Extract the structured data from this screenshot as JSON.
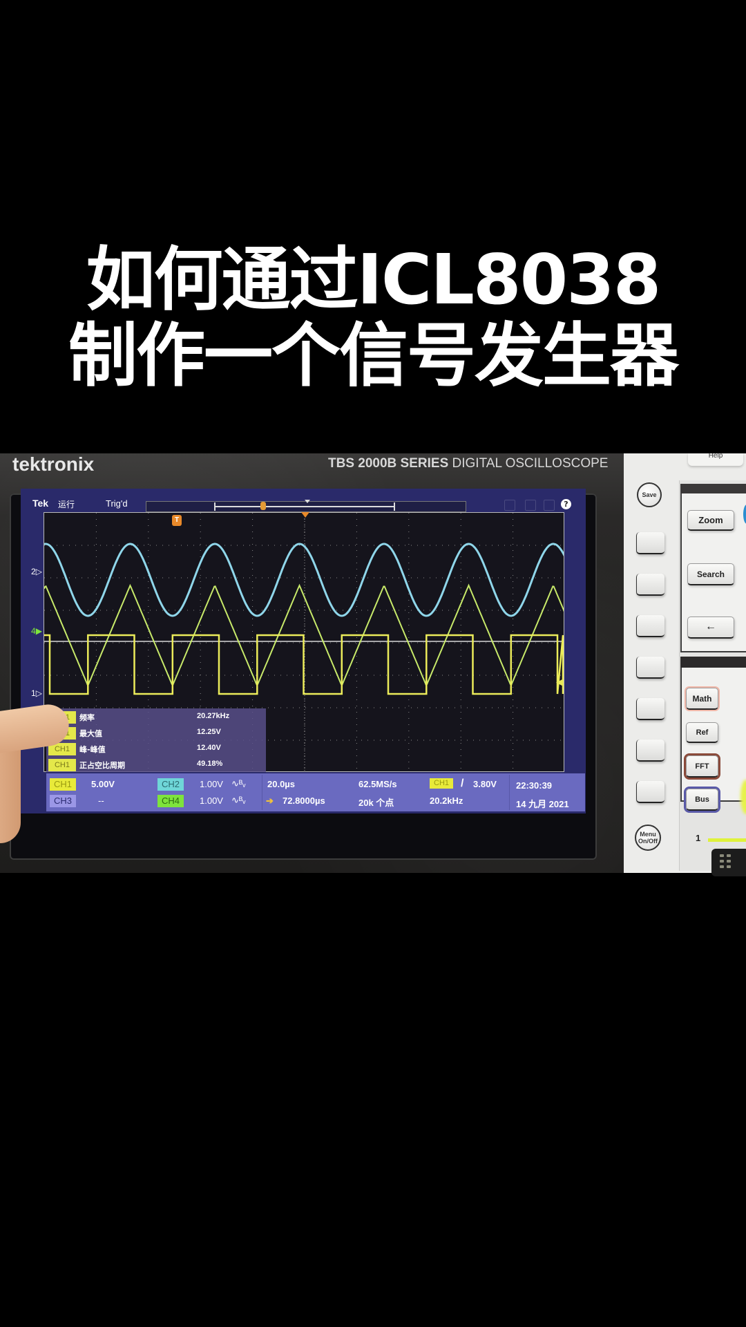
{
  "title": {
    "line1": "如何通过ICL8038",
    "line2": "制作一个信号发生器"
  },
  "instrument": {
    "brand": "tektronix",
    "model_bold": "TBS 2000B SERIES",
    "model_rest": "DIGITAL OSCILLOSCOPE"
  },
  "screen": {
    "topbar": {
      "tek": "Tek",
      "run_state": "运行",
      "trigger_state": "Trig'd",
      "help_icon": "?"
    },
    "channel_markers": {
      "ch2": "2",
      "ch4": "4",
      "ch1": "1",
      "trigger_marker": "T"
    },
    "waveforms": [
      {
        "channel": "CH2",
        "shape": "sine",
        "color": "#8fd6ea",
        "cycles_visible": 6
      },
      {
        "channel": "CH4",
        "shape": "triangle",
        "color": "#c8ea6a",
        "cycles_visible": 6
      },
      {
        "channel": "CH1",
        "shape": "square",
        "color": "#ecec5a",
        "cycles_visible": 6
      }
    ],
    "measurements": [
      {
        "channel": "CH1",
        "label": "频率",
        "value": "20.27kHz"
      },
      {
        "channel": "CH1",
        "label": "最大值",
        "value": "12.25V"
      },
      {
        "channel": "CH1",
        "label": "峰-峰值",
        "value": "12.40V"
      },
      {
        "channel": "CH1",
        "label": "正占空比周期",
        "value": "49.18%"
      }
    ],
    "status": {
      "ch1_label": "CH1",
      "ch1_scale": "5.00V",
      "ch2_label": "CH2",
      "ch2_scale": "1.00V",
      "ch2_coupling": "∿ᴮᵥ",
      "ch3_label": "CH3",
      "ch3_scale": "--",
      "ch4_label": "CH4",
      "ch4_scale": "1.00V",
      "ch4_coupling": "∿ᴮᵥ",
      "timebase": "20.0µs",
      "position": "72.8000µs",
      "sample_rate": "62.5MS/s",
      "record_length": "20k 个点",
      "trigger_source": "CH1",
      "trigger_slope": "/",
      "trigger_level": "3.80V",
      "trigger_freq": "20.2kHz",
      "time": "22:30:39",
      "date": "14 九月 2021"
    }
  },
  "panel": {
    "help_label": "Help",
    "save_label": "Save",
    "zoom_label": "Zoom",
    "search_label": "Search",
    "back_arrow": "←",
    "math_label": "Math",
    "ref_label": "Ref",
    "fft_label": "FFT",
    "bus_label": "Bus",
    "menu_label_1": "Menu",
    "menu_label_2": "On/Off",
    "channel_number": "1"
  },
  "colors": {
    "ch1": "#e8ea3a",
    "ch2": "#6fd6d8",
    "ch3": "#9b97e6",
    "ch4": "#7ee43c",
    "screen_bg": "#15141c",
    "status_bg": "#6a6ac0"
  }
}
